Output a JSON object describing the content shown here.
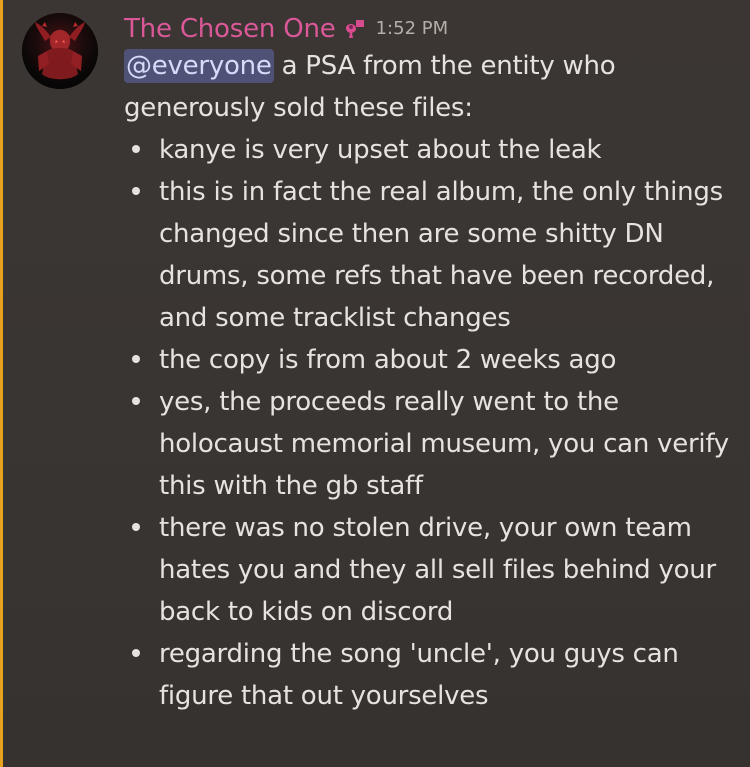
{
  "message": {
    "username": "The Chosen One",
    "timestamp": "1:52 PM",
    "mention": "@everyone",
    "intro_text": "a PSA from the entity who generously sold these files:",
    "bullets": [
      "kanye is very upset about the leak",
      "this is in fact the real album, the only things changed since then are some shitty DN drums, some refs that have been recorded, and some tracklist changes",
      "the copy is from about 2 weeks ago",
      "yes, the proceeds really went to the holocaust memorial museum, you can verify this with the gb staff",
      "there was no stolen drive, your own team hates you and they all sell files behind your back to kids on discord",
      "regarding the song 'uncle', you guys can figure that out yourselves"
    ]
  },
  "icons": {
    "role": "role-badge-icon",
    "avatar": "avatar-image"
  },
  "colors": {
    "background": "#393533",
    "username": "#da5897",
    "mention_background": "#4f5276",
    "mention_text": "#d7daf9",
    "text": "#e6e3df",
    "timestamp": "#b5aea8",
    "accent": "#e7a11d"
  }
}
